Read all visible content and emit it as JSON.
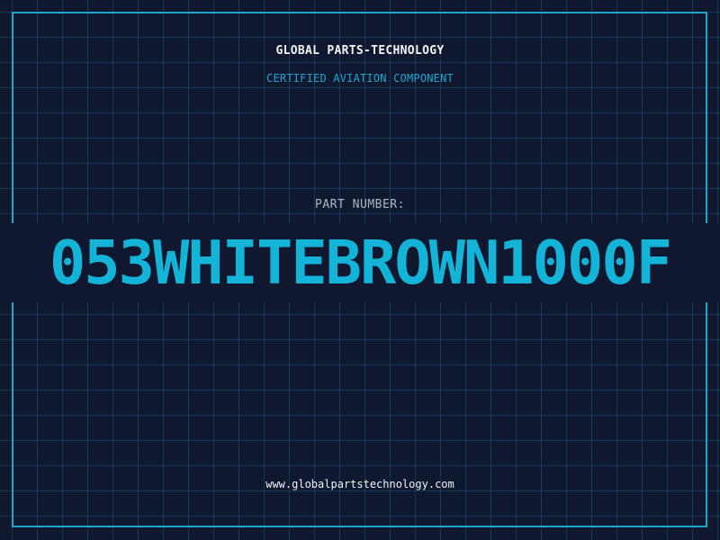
{
  "header": {
    "brand": "GLOBAL PARTS-TECHNOLOGY",
    "tagline": "CERTIFIED AVIATION COMPONENT"
  },
  "part": {
    "label": "PART NUMBER:",
    "number": "053WHITEBROWN1000F"
  },
  "footer": {
    "url": "www.globalpartstechnology.com"
  },
  "colors": {
    "background": "#101830",
    "accent": "#14b4d8",
    "grid": "#1f6f86",
    "text": "#f2f4f8"
  }
}
